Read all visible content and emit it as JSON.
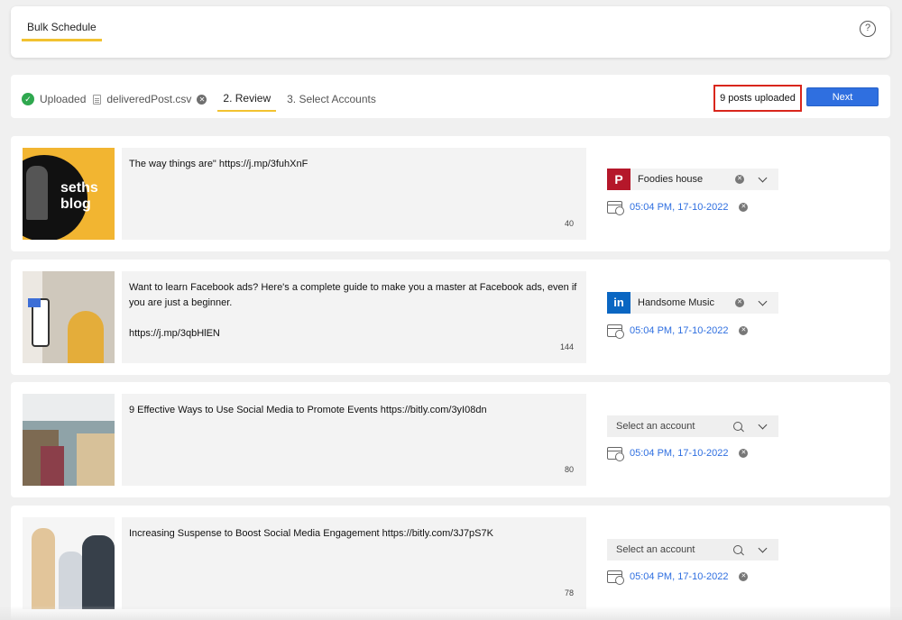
{
  "header": {
    "tab_label": "Bulk Schedule",
    "help_label": "?"
  },
  "steps": {
    "uploaded_label": "Uploaded",
    "file_name": "deliveredPost.csv",
    "review_label": "2. Review",
    "accounts_label": "3. Select Accounts"
  },
  "summary": {
    "posts_uploaded": "9  posts uploaded",
    "next_label": "Next"
  },
  "posts": [
    {
      "thumb_text": "seths blog",
      "text": "The way things are\" https://j.mp/3fuhXnF",
      "count": "40",
      "account": {
        "name": "Foodies house",
        "network": "pinterest",
        "logo": "P"
      },
      "schedule": "05:04 PM, 17-10-2022"
    },
    {
      "text": "Want to learn Facebook ads? Here's a complete guide to make you a master at Facebook ads, even if you are just a beginner.\n\nhttps://j.mp/3qbHlEN",
      "count": "144",
      "account": {
        "name": "Handsome Music",
        "network": "linkedin",
        "logo": "in"
      },
      "schedule": "05:04 PM, 17-10-2022"
    },
    {
      "text": "9 Effective Ways to Use Social Media to Promote Events https://bitly.com/3yI08dn",
      "count": "80",
      "account_placeholder": "Select an account",
      "schedule": "05:04 PM, 17-10-2022"
    },
    {
      "text": "Increasing Suspense to Boost Social Media Engagement https://bitly.com/3J7pS7K",
      "count": "78",
      "account_placeholder": "Select an account",
      "schedule": "05:04 PM, 17-10-2022"
    }
  ],
  "colors": {
    "accent_yellow": "#f2c230",
    "primary_blue": "#2f6fe0",
    "highlight_red": "#d9261c",
    "pinterest": "#b5172a",
    "linkedin": "#0a66c2"
  }
}
